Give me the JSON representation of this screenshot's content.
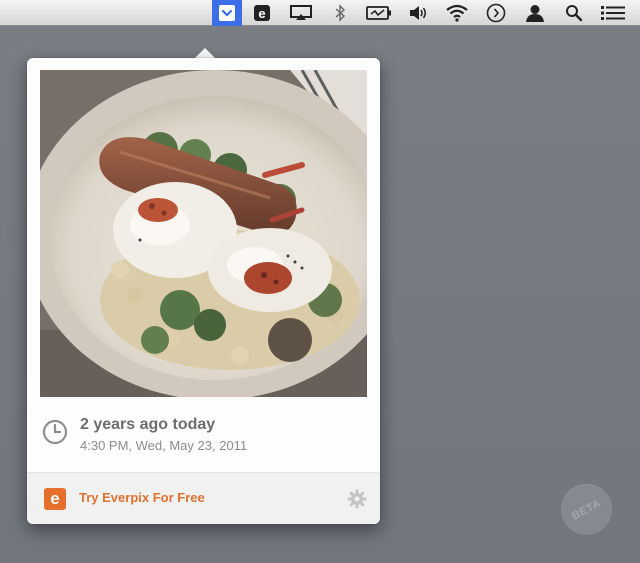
{
  "menubar": {
    "items": [
      {
        "icon": "everpix-menu-icon",
        "active": true
      },
      {
        "icon": "evernote-icon"
      },
      {
        "icon": "airplay-icon"
      },
      {
        "icon": "bluetooth-icon"
      },
      {
        "icon": "battery-charging-icon"
      },
      {
        "icon": "volume-icon"
      },
      {
        "icon": "wifi-icon"
      },
      {
        "icon": "time-machine-icon"
      },
      {
        "icon": "user-icon"
      },
      {
        "icon": "spotlight-search-icon"
      },
      {
        "icon": "notification-center-icon"
      }
    ]
  },
  "popover": {
    "photo": {
      "subject": "sausage-poached-eggs-brussels-sprouts-dish"
    },
    "flashback_title": "2 years ago today",
    "flashback_timestamp": "4:30 PM, Wed, May 23, 2011",
    "footer": {
      "promo_label": "Try Everpix For Free",
      "logo_letter": "e"
    }
  },
  "beta_badge": {
    "label": "BETA"
  },
  "colors": {
    "accent": "#e0712f",
    "menu_highlight": "#3c6ee8",
    "desktop": "#75797f"
  }
}
